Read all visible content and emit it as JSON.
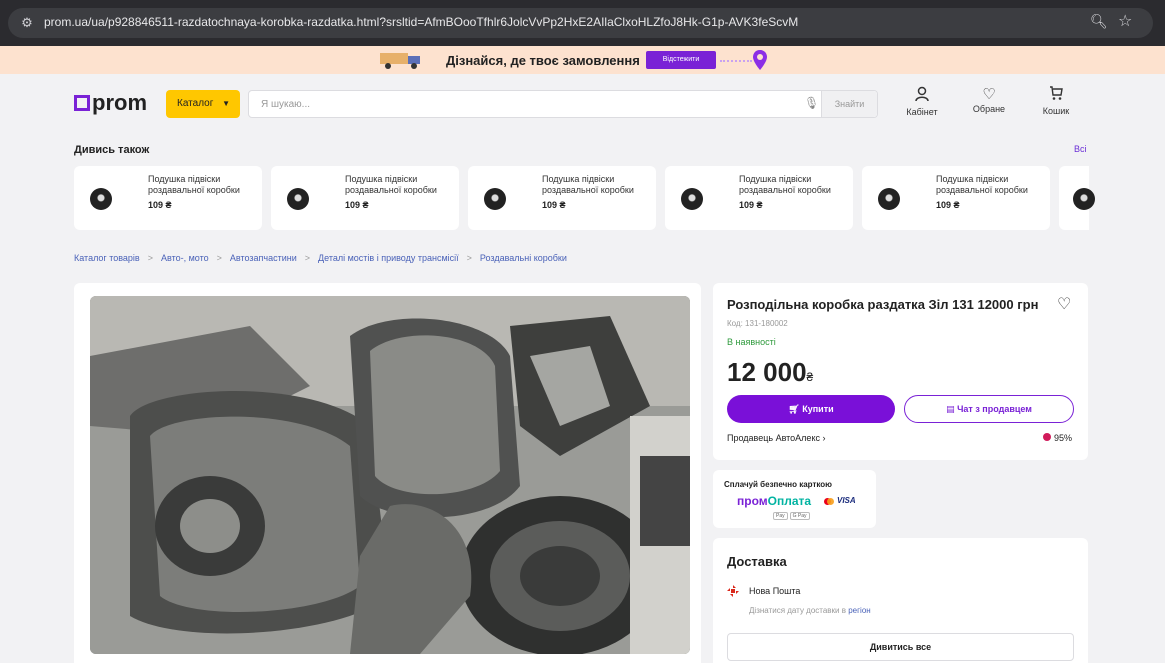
{
  "browser": {
    "url": "prom.ua/ua/p928846511-razdatochnaya-korobka-razdatka.html?srsltid=AfmBOooTfhlr6JolcVvPp2HxE2AIlaClxoHLZfoJ8Hk-G1p-AVK3feScvM"
  },
  "banner": {
    "text": "Дізнайся, де твоє замовлення",
    "button": "Відстежити"
  },
  "header": {
    "logo": "prom",
    "catalog": "Каталог",
    "search_placeholder": "Я шукаю...",
    "search_button": "Знайти",
    "cabinet": "Кабінет",
    "favorites": "Обране",
    "cart": "Кошик"
  },
  "see_also": {
    "title": "Дивись також",
    "all": "Всі",
    "items": [
      {
        "title": "Подушка підвіски роздавальної коробки",
        "price": "109 ₴"
      },
      {
        "title": "Подушка підвіски роздавальної коробки",
        "price": "109 ₴"
      },
      {
        "title": "Подушка підвіски роздавальної коробки",
        "price": "109 ₴"
      },
      {
        "title": "Подушка підвіски роздавальної коробки",
        "price": "109 ₴"
      },
      {
        "title": "Подушка підвіски роздавальної коробки",
        "price": "109 ₴"
      }
    ]
  },
  "breadcrumbs": [
    "Каталог товарів",
    "Авто-, мото",
    "Автозапчастини",
    "Деталі мостів і приводу трансмісії",
    "Роздавальні коробки"
  ],
  "product": {
    "title": "Розподільна коробка раздатка Зіл 131 12000 грн",
    "code": "Код: 131-180002",
    "stock": "В наявності",
    "price": "12 000",
    "currency": "₴",
    "buy": "Купити",
    "chat": "Чат з продавцем",
    "seller": "Продавець АвтоАлекс",
    "rating": "95%"
  },
  "payment": {
    "title": "Сплачуй безпечно карткою",
    "brand_a": "пром",
    "brand_b": "Оплата",
    "visa": "VISA",
    "badge_a": "Pay",
    "badge_b": "G Pay"
  },
  "delivery": {
    "title": "Доставка",
    "carrier": "Нова Пошта",
    "hint": "Дізнатися дату доставки в ",
    "region": "регіон",
    "all": "Дивитись все"
  },
  "colors": {
    "accent": "#7a22d6",
    "catalog": "#ffc700",
    "stock": "#2e9a3c"
  }
}
